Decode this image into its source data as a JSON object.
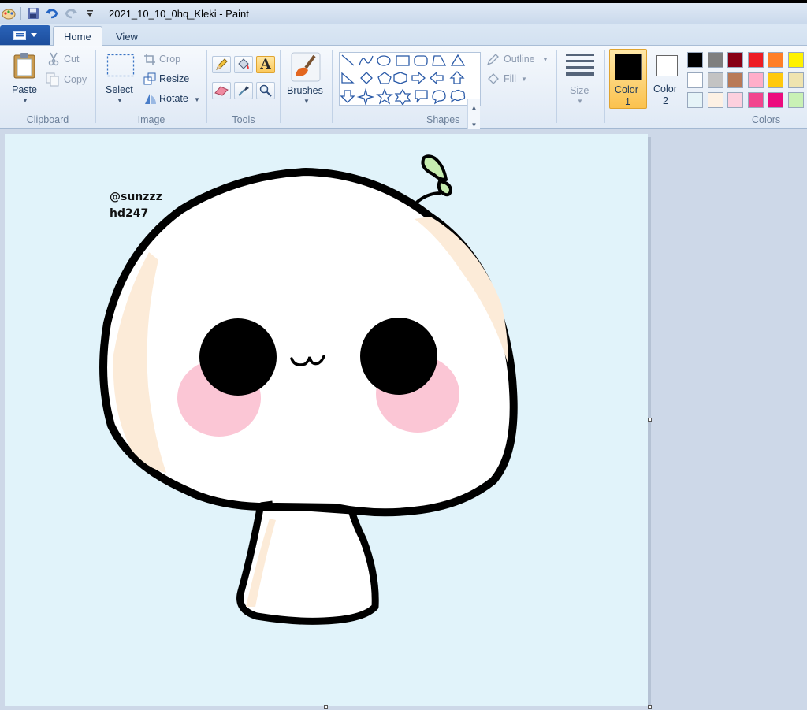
{
  "window": {
    "title": "2021_10_10_0hq_Kleki - Paint"
  },
  "quick_access": {
    "icons": [
      "paint-app-icon",
      "save-icon",
      "undo-icon",
      "redo-icon",
      "customize-dropdown-icon"
    ]
  },
  "tabs": [
    {
      "label": "Home",
      "active": true
    },
    {
      "label": "View",
      "active": false
    }
  ],
  "ribbon": {
    "clipboard": {
      "label": "Clipboard",
      "paste": "Paste",
      "cut": "Cut",
      "copy": "Copy"
    },
    "image": {
      "label": "Image",
      "select": "Select",
      "crop": "Crop",
      "resize": "Resize",
      "rotate": "Rotate"
    },
    "tools": {
      "label": "Tools",
      "icons": [
        "pencil-icon",
        "fill-bucket-icon",
        "text-icon",
        "eraser-icon",
        "color-picker-icon",
        "magnifier-icon"
      ],
      "selected": "text-icon"
    },
    "brushes": {
      "label": "Brushes"
    },
    "shapes": {
      "label": "Shapes",
      "outline": "Outline",
      "fill": "Fill"
    },
    "size": {
      "label": "Size"
    },
    "colors": {
      "label": "Colors",
      "color1": {
        "label_line1": "Color",
        "label_line2": "1",
        "value": "#000000"
      },
      "color2": {
        "label_line1": "Color",
        "label_line2": "2",
        "value": "#ffffff"
      },
      "palette": [
        [
          "#000000",
          "#7f7f7f",
          "#880015",
          "#ed1c24",
          "#ff7f27",
          "#fff200"
        ],
        [
          "#ffffff",
          "#c3c3c3",
          "#b97a57",
          "#ffaec9",
          "#ffc90e",
          "#efe4b0"
        ],
        [
          "#e6f4f8",
          "#fdf1e4",
          "#fdd0de",
          "#f2468e",
          "#ec0c7e",
          "#c9f1b5"
        ]
      ]
    }
  },
  "canvas": {
    "background": "#e1f3fa",
    "signature_line1": "@sunzzz",
    "signature_line2": "hd247"
  }
}
